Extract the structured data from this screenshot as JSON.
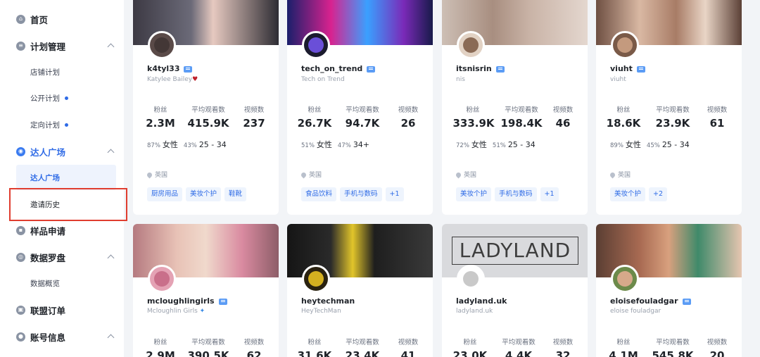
{
  "sidebar": {
    "home": "首页",
    "plan_mgmt": "计划管理",
    "plan_items": [
      "店铺计划",
      "公开计划",
      "定向计划"
    ],
    "creator_square": "达人广场",
    "creator_items": [
      "达人广场",
      "邀请历史"
    ],
    "sample_request": "样品申请",
    "data_compass": "数据罗盘",
    "data_items": [
      "数据概览"
    ],
    "affiliate_orders": "联盟订单",
    "account_info": "账号信息"
  },
  "stat_labels": [
    "粉丝",
    "平均观看数",
    "视频数"
  ],
  "gender_label": "女性",
  "location": "英国",
  "cards": [
    {
      "username": "k4tyl33",
      "display": "Katylee Bailey",
      "followers": "2.3M",
      "avg_views": "415.9K",
      "videos": "237",
      "female_pct": "87%",
      "age_pct": "43%",
      "age": "25 - 34",
      "tags": [
        "厨房用品",
        "美妆个护",
        "鞋靴"
      ]
    },
    {
      "username": "tech_on_trend",
      "display": "Tech on Trend",
      "followers": "26.7K",
      "avg_views": "94.7K",
      "videos": "26",
      "female_pct": "51%",
      "age_pct": "47%",
      "age": "34+",
      "tags": [
        "食品饮料",
        "手机与数码",
        "+1"
      ]
    },
    {
      "username": "itsnisrin",
      "display": "nis",
      "followers": "333.9K",
      "avg_views": "198.4K",
      "videos": "46",
      "female_pct": "72%",
      "age_pct": "51%",
      "age": "25 - 34",
      "tags": [
        "美妆个护",
        "手机与数码",
        "+1"
      ]
    },
    {
      "username": "viuht",
      "display": "viuht",
      "followers": "18.6K",
      "avg_views": "23.9K",
      "videos": "61",
      "female_pct": "89%",
      "age_pct": "45%",
      "age": "25 - 34",
      "tags": [
        "美妆个护",
        "+2"
      ]
    },
    {
      "username": "mcloughlingirls",
      "display": "Mcloughlin Girls",
      "followers": "2.9M",
      "avg_views": "390.5K",
      "videos": "62"
    },
    {
      "username": "heytechman",
      "display": "HeyTechMan",
      "followers": "31.6K",
      "avg_views": "23.4K",
      "videos": "41"
    },
    {
      "username": "ladyland.uk",
      "display": "ladyland.uk",
      "followers": "23.0K",
      "avg_views": "4.4K",
      "videos": "32",
      "cover_text": "LADYLAND"
    },
    {
      "username": "eloisefouladgar",
      "display": "eloise fouladgar",
      "followers": "4.1M",
      "avg_views": "545.8K",
      "videos": "20"
    }
  ],
  "colors": {
    "accent": "#2f6be6",
    "highlight": "#e03d2f",
    "tag_bg": "#eef4fd"
  }
}
